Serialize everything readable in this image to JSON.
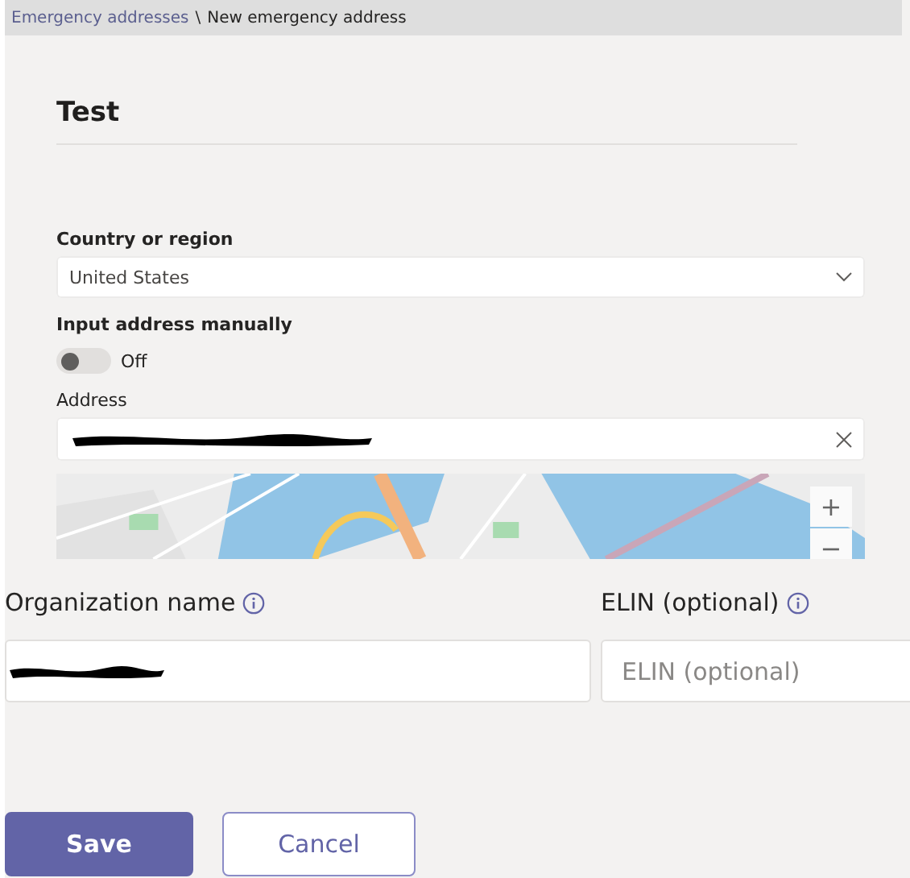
{
  "breadcrumb": [
    {
      "label": "Emergency addresses",
      "link": true
    },
    {
      "label": "\\",
      "link": false
    },
    {
      "label": "New emergency address",
      "link": false
    }
  ],
  "title": "Test",
  "country": {
    "label": "Country or region",
    "value": "United States"
  },
  "manual_input": {
    "label": "Input address manually",
    "on": false,
    "state_text": "Off"
  },
  "address": {
    "label": "Address",
    "redacted": true
  },
  "map": {
    "zoom_in": "+",
    "zoom_out": "−"
  },
  "organization": {
    "label": "Organization name",
    "redacted": true
  },
  "elin": {
    "label": "ELIN (optional)",
    "placeholder": "ELIN (optional)"
  },
  "buttons": [
    {
      "label": "Save",
      "kind": "primary"
    },
    {
      "label": "Cancel",
      "kind": "secondary"
    }
  ]
}
